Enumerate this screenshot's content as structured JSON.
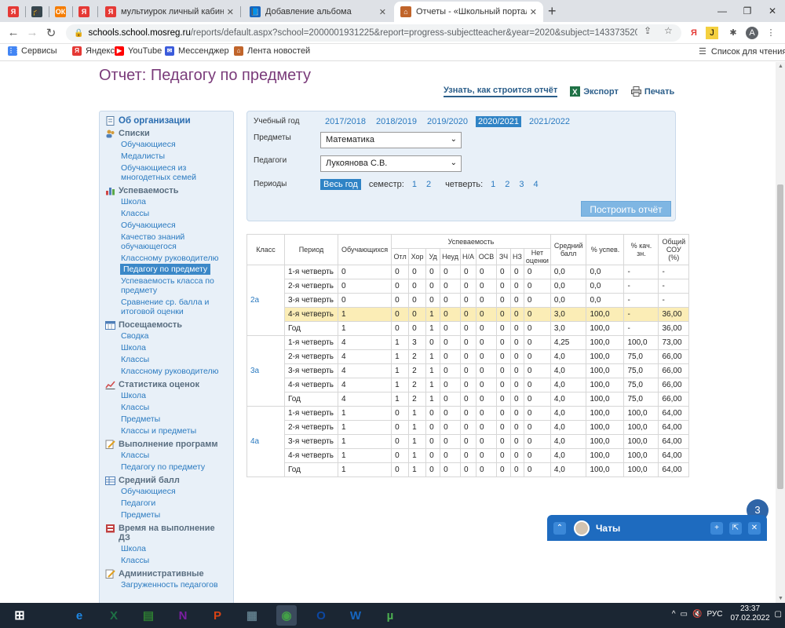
{
  "browser": {
    "tabs": [
      {
        "title": "",
        "icon": "yandex-icon",
        "color": "#e53935"
      },
      {
        "title": "",
        "icon": "graduation-cap-icon",
        "color": "#37474f"
      },
      {
        "title": "",
        "icon": "ok-icon",
        "color": "#f57c00"
      },
      {
        "title": "",
        "icon": "yandex-icon",
        "color": "#e53935"
      },
      {
        "title": "мультиурок личный кабинет вх",
        "icon": "yandex-icon",
        "color": "#e53935"
      },
      {
        "title": "Добавление альбома",
        "icon": "book-icon",
        "color": "#1565c0"
      },
      {
        "title": "Отчеты - «Школьный портал»",
        "icon": "school-icon",
        "color": "#c0642a",
        "active": true
      }
    ],
    "url_host": "schools.school.mosreg.ru",
    "url_path": "/reports/default.aspx?school=2000001931225&report=progress-subjectteacher&year=2020&subject=1433735204294...",
    "profile": "A",
    "bookmarks": [
      {
        "label": "Сервисы",
        "icon": "apps-icon",
        "color": "#4285f4"
      },
      {
        "label": "Яндекс",
        "icon": "yandex-icon",
        "color": "#e53935"
      },
      {
        "label": "YouTube",
        "icon": "youtube-icon",
        "color": "#ff0000"
      },
      {
        "label": "Мессенджер",
        "icon": "messenger-icon",
        "color": "#3b5bdb"
      },
      {
        "label": "Лента новостей",
        "icon": "news-icon",
        "color": "#c0642a"
      }
    ],
    "reading_list": "Список для чтения"
  },
  "page": {
    "title": "Отчет: Педагогу по предмету",
    "learn_link": "Узнать, как строится отчёт",
    "export_label": "Экспорт",
    "print_label": "Печать"
  },
  "sidebar": {
    "org": "Об организации",
    "sections": [
      {
        "title": "Списки",
        "icon": "people-icon",
        "items": [
          "Обучающиеся",
          "Медалисты",
          "Обучающиеся из многодетных семей"
        ]
      },
      {
        "title": "Успеваемость",
        "icon": "bar-chart-icon",
        "items": [
          "Школа",
          "Классы",
          "Обучающиеся",
          "Качество знаний обучающегося",
          "Классному руководителю",
          "Педагогу по предмету",
          "Успеваемость класса по предмету",
          "Сравнение ср. балла и итоговой оценки"
        ],
        "selected": 5
      },
      {
        "title": "Посещаемость",
        "icon": "calendar-icon",
        "items": [
          "Сводка",
          "Школа",
          "Классы",
          "Классному руководителю"
        ]
      },
      {
        "title": "Статистика оценок",
        "icon": "line-chart-icon",
        "items": [
          "Школа",
          "Классы",
          "Предметы",
          "Классы и предметы"
        ]
      },
      {
        "title": "Выполнение программ",
        "icon": "pencil-icon",
        "items": [
          "Классы",
          "Педагогу по предмету"
        ]
      },
      {
        "title": "Средний балл",
        "icon": "table-icon",
        "items": [
          "Обучающиеся",
          "Педагоги",
          "Предметы"
        ]
      },
      {
        "title": "Время на выполнение ДЗ",
        "icon": "clock-icon",
        "items": [
          "Школа",
          "Классы"
        ]
      },
      {
        "title": "Административные",
        "icon": "pencil-icon",
        "items": [
          "Загруженность педагогов"
        ]
      }
    ]
  },
  "filter": {
    "year_label": "Учебный год",
    "years": [
      "2017/2018",
      "2018/2019",
      "2019/2020",
      "2020/2021",
      "2021/2022"
    ],
    "selected_year": 3,
    "subjects_label": "Предметы",
    "subject_value": "Математика",
    "teachers_label": "Педагоги",
    "teacher_value": "Лукоянова С.В.",
    "periods_label": "Периоды",
    "whole_year": "Весь год",
    "semester_label": "семестр:",
    "semesters": [
      "1",
      "2"
    ],
    "quarter_label": "четверть:",
    "quarters": [
      "1",
      "2",
      "3",
      "4"
    ],
    "build_button": "Построить отчёт"
  },
  "table": {
    "headers": {
      "class": "Класс",
      "period": "Период",
      "students": "Обучающихся",
      "progress": "Успеваемость",
      "sub": [
        "Отл",
        "Хор",
        "Уд",
        "Неуд",
        "Н/А",
        "ОСВ",
        "ЗЧ",
        "НЗ",
        "Нет оценки"
      ],
      "avg": "Средний балл",
      "pct_pass": "% успев.",
      "pct_quality": "% кач. зн.",
      "sou": "Общий СОУ (%)"
    },
    "groups": [
      {
        "class": "2а",
        "rows": [
          [
            "1-я четверть",
            "0",
            "0",
            "0",
            "0",
            "0",
            "0",
            "0",
            "0",
            "0",
            "0",
            "0,0",
            "0,0",
            "-",
            "-"
          ],
          [
            "2-я четверть",
            "0",
            "0",
            "0",
            "0",
            "0",
            "0",
            "0",
            "0",
            "0",
            "0",
            "0,0",
            "0,0",
            "-",
            "-"
          ],
          [
            "3-я четверть",
            "0",
            "0",
            "0",
            "0",
            "0",
            "0",
            "0",
            "0",
            "0",
            "0",
            "0,0",
            "0,0",
            "-",
            "-"
          ],
          [
            "4-я четверть",
            "1",
            "0",
            "0",
            "1",
            "0",
            "0",
            "0",
            "0",
            "0",
            "0",
            "3,0",
            "100,0",
            "-",
            "36,00"
          ],
          [
            "Год",
            "1",
            "0",
            "0",
            "1",
            "0",
            "0",
            "0",
            "0",
            "0",
            "0",
            "3,0",
            "100,0",
            "-",
            "36,00"
          ]
        ],
        "highlight": 3
      },
      {
        "class": "3а",
        "rows": [
          [
            "1-я четверть",
            "4",
            "1",
            "3",
            "0",
            "0",
            "0",
            "0",
            "0",
            "0",
            "0",
            "4,25",
            "100,0",
            "100,0",
            "73,00"
          ],
          [
            "2-я четверть",
            "4",
            "1",
            "2",
            "1",
            "0",
            "0",
            "0",
            "0",
            "0",
            "0",
            "4,0",
            "100,0",
            "75,0",
            "66,00"
          ],
          [
            "3-я четверть",
            "4",
            "1",
            "2",
            "1",
            "0",
            "0",
            "0",
            "0",
            "0",
            "0",
            "4,0",
            "100,0",
            "75,0",
            "66,00"
          ],
          [
            "4-я четверть",
            "4",
            "1",
            "2",
            "1",
            "0",
            "0",
            "0",
            "0",
            "0",
            "0",
            "4,0",
            "100,0",
            "75,0",
            "66,00"
          ],
          [
            "Год",
            "4",
            "1",
            "2",
            "1",
            "0",
            "0",
            "0",
            "0",
            "0",
            "0",
            "4,0",
            "100,0",
            "75,0",
            "66,00"
          ]
        ]
      },
      {
        "class": "4а",
        "rows": [
          [
            "1-я четверть",
            "1",
            "0",
            "1",
            "0",
            "0",
            "0",
            "0",
            "0",
            "0",
            "0",
            "4,0",
            "100,0",
            "100,0",
            "64,00"
          ],
          [
            "2-я четверть",
            "1",
            "0",
            "1",
            "0",
            "0",
            "0",
            "0",
            "0",
            "0",
            "0",
            "4,0",
            "100,0",
            "100,0",
            "64,00"
          ],
          [
            "3-я четверть",
            "1",
            "0",
            "1",
            "0",
            "0",
            "0",
            "0",
            "0",
            "0",
            "0",
            "4,0",
            "100,0",
            "100,0",
            "64,00"
          ],
          [
            "4-я четверть",
            "1",
            "0",
            "1",
            "0",
            "0",
            "0",
            "0",
            "0",
            "0",
            "0",
            "4,0",
            "100,0",
            "100,0",
            "64,00"
          ],
          [
            "Год",
            "1",
            "0",
            "1",
            "0",
            "0",
            "0",
            "0",
            "0",
            "0",
            "0",
            "4,0",
            "100,0",
            "100,0",
            "64,00"
          ]
        ]
      }
    ]
  },
  "chats": {
    "title": "Чаты",
    "badge": "3"
  },
  "taskbar": {
    "apps": [
      {
        "name": "ie-icon",
        "label": "e",
        "color": "#1e88e5"
      },
      {
        "name": "excel-icon",
        "label": "X",
        "color": "#1e7145"
      },
      {
        "name": "word-green-icon",
        "label": "▤",
        "color": "#2e7d32"
      },
      {
        "name": "onenote-icon",
        "label": "N",
        "color": "#7b1fa2"
      },
      {
        "name": "powerpoint-icon",
        "label": "P",
        "color": "#d84315"
      },
      {
        "name": "calculator-icon",
        "label": "▦",
        "color": "#607d8b"
      },
      {
        "name": "chrome-icon",
        "label": "◉",
        "color": "#43a047",
        "active": true
      },
      {
        "name": "outlook-icon",
        "label": "O",
        "color": "#0d47a1"
      },
      {
        "name": "word-icon",
        "label": "W",
        "color": "#1565c0"
      },
      {
        "name": "utorrent-icon",
        "label": "µ",
        "color": "#4caf50"
      }
    ],
    "lang": "РУС",
    "time": "23:37",
    "date": "07.02.2022"
  }
}
